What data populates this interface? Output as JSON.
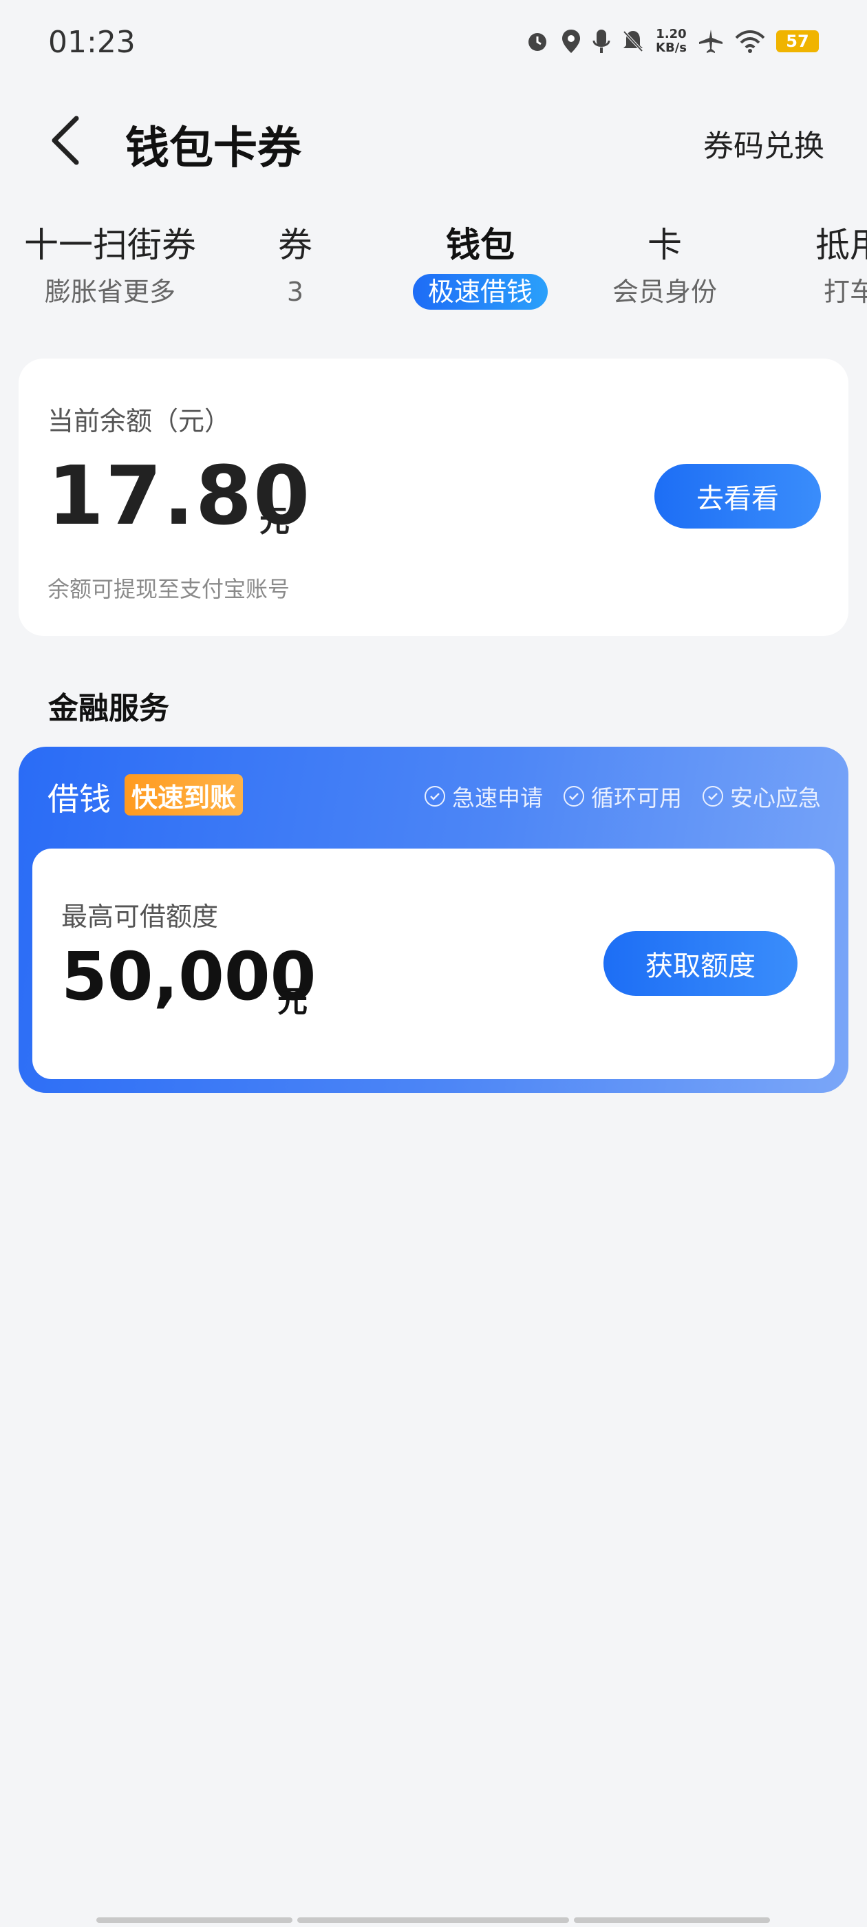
{
  "status_bar": {
    "time": "01:23",
    "network_speed_value": "1.20",
    "network_speed_unit": "KB/s",
    "battery": "57",
    "icons": [
      "alarm-icon",
      "location-icon",
      "microphone-icon",
      "bell-muted-icon",
      "airplane-icon",
      "wifi-icon",
      "battery-icon"
    ]
  },
  "header": {
    "title": "钱包卡券",
    "redeem_label": "券码兑换"
  },
  "tabs": [
    {
      "title": "十一扫街券",
      "sub": "膨胀省更多"
    },
    {
      "title": "券",
      "sub": "3"
    },
    {
      "title": "钱包",
      "sub": "极速借钱",
      "active": true
    },
    {
      "title": "卡",
      "sub": "会员身份"
    },
    {
      "title": "抵用",
      "sub": "打车"
    }
  ],
  "balance": {
    "label": "当前余额（元）",
    "amount": "17.80",
    "unit": "元",
    "note": "余额可提现至支付宝账号",
    "button_label": "去看看"
  },
  "finance": {
    "section_title": "金融服务",
    "card_title": "借钱",
    "badge": "快速到账",
    "features": [
      "急速申请",
      "循环可用",
      "安心应急"
    ],
    "limit_label": "最高可借额度",
    "limit_amount": "50,000",
    "limit_unit": "元",
    "button_label": "获取额度"
  },
  "colors": {
    "accent": "#1d6ef5",
    "badge": "#ff9a1f",
    "background": "#f4f5f7"
  }
}
